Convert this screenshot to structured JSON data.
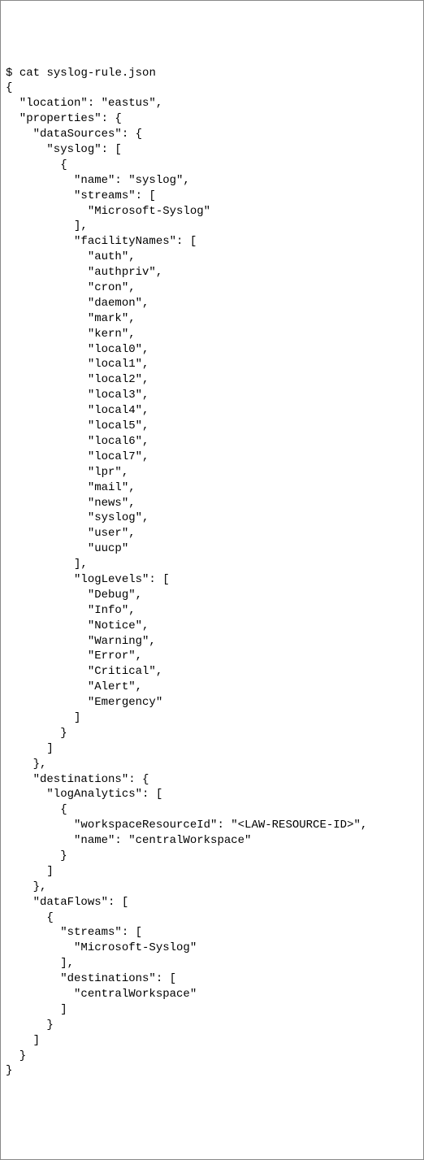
{
  "command": {
    "prompt": "$",
    "cmd": "cat",
    "arg": "syslog-rule.json"
  },
  "json_content": {
    "location": "eastus",
    "properties": {
      "dataSources": {
        "syslog": [
          {
            "name": "syslog",
            "streams": [
              "Microsoft-Syslog"
            ],
            "facilityNames": [
              "auth",
              "authpriv",
              "cron",
              "daemon",
              "mark",
              "kern",
              "local0",
              "local1",
              "local2",
              "local3",
              "local4",
              "local5",
              "local6",
              "local7",
              "lpr",
              "mail",
              "news",
              "syslog",
              "user",
              "uucp"
            ],
            "logLevels": [
              "Debug",
              "Info",
              "Notice",
              "Warning",
              "Error",
              "Critical",
              "Alert",
              "Emergency"
            ]
          }
        ]
      },
      "destinations": {
        "logAnalytics": [
          {
            "workspaceResourceId": "<LAW-RESOURCE-ID>",
            "name": "centralWorkspace"
          }
        ]
      },
      "dataFlows": [
        {
          "streams": [
            "Microsoft-Syslog"
          ],
          "destinations": [
            "centralWorkspace"
          ]
        }
      ]
    }
  }
}
